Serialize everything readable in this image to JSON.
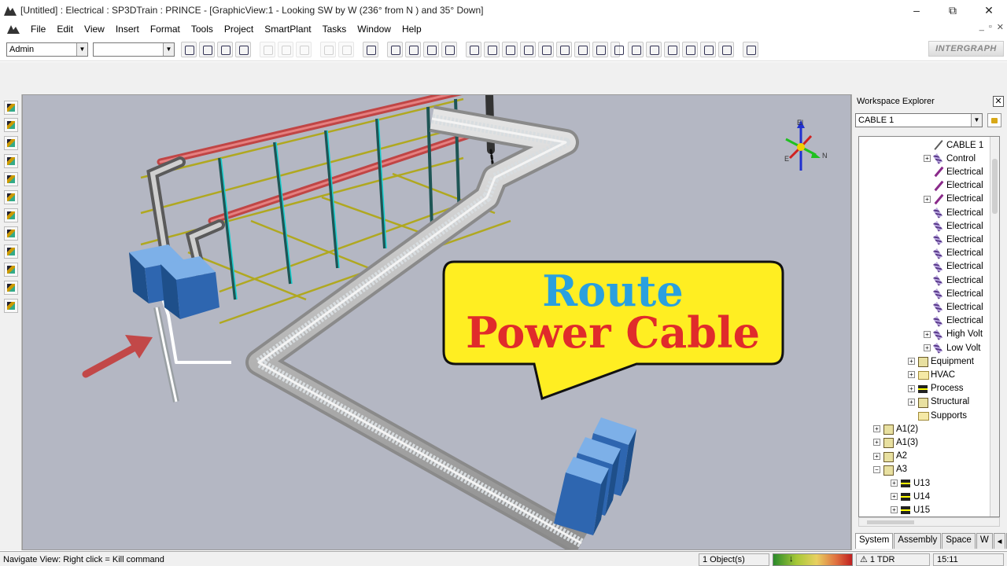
{
  "window": {
    "title": "[Untitled] : Electrical : SP3DTrain : PRINCE - [GraphicView:1 - Looking SW by W (236° from N ) and 35° Down]",
    "min": "–",
    "max": "⧉",
    "close": "✕"
  },
  "menu": [
    "File",
    "Edit",
    "View",
    "Insert",
    "Format",
    "Tools",
    "Project",
    "SmartPlant",
    "Tasks",
    "Window",
    "Help"
  ],
  "toolbar": {
    "user_combo": "Admin",
    "filter_combo": "",
    "logo": "INTERGRAPH"
  },
  "compass": {
    "up": "El",
    "east": "N",
    "west": "E"
  },
  "callout": {
    "line1": "Route",
    "line2": "Power Cable",
    "line1_color": "#2aa0de",
    "line2_color": "#e02b2b",
    "bg": "#ffee22"
  },
  "explorer": {
    "title": "Workspace Explorer",
    "combo": "CABLE 1",
    "tree": [
      {
        "label": "CABLE 1",
        "icon": "pen",
        "level": 4,
        "exp": ""
      },
      {
        "label": "Control",
        "icon": "cable",
        "level": 4,
        "exp": "+"
      },
      {
        "label": "Electrical",
        "icon": "pen2",
        "level": 4,
        "exp": ""
      },
      {
        "label": "Electrical",
        "icon": "pen2",
        "level": 4,
        "exp": ""
      },
      {
        "label": "Electrical",
        "icon": "pen2",
        "level": 4,
        "exp": "+"
      },
      {
        "label": "Electrical",
        "icon": "cable",
        "level": 4,
        "exp": ""
      },
      {
        "label": "Electrical",
        "icon": "cable",
        "level": 4,
        "exp": ""
      },
      {
        "label": "Electrical",
        "icon": "cable",
        "level": 4,
        "exp": ""
      },
      {
        "label": "Electrical",
        "icon": "cable",
        "level": 4,
        "exp": ""
      },
      {
        "label": "Electrical",
        "icon": "cable",
        "level": 4,
        "exp": ""
      },
      {
        "label": "Electrical",
        "icon": "cable",
        "level": 4,
        "exp": ""
      },
      {
        "label": "Electrical",
        "icon": "cable",
        "level": 4,
        "exp": ""
      },
      {
        "label": "Electrical",
        "icon": "cable",
        "level": 4,
        "exp": ""
      },
      {
        "label": "Electrical",
        "icon": "cable",
        "level": 4,
        "exp": ""
      },
      {
        "label": "High Volt",
        "icon": "cable",
        "level": 4,
        "exp": "+"
      },
      {
        "label": "Low Volt",
        "icon": "cable",
        "level": 4,
        "exp": "+"
      },
      {
        "label": "Equipment",
        "icon": "box",
        "level": 3,
        "exp": "+"
      },
      {
        "label": "HVAC",
        "icon": "folder",
        "level": 3,
        "exp": "+"
      },
      {
        "label": "Process",
        "icon": "plant",
        "level": 3,
        "exp": "+"
      },
      {
        "label": "Structural",
        "icon": "box",
        "level": 3,
        "exp": "+"
      },
      {
        "label": "Supports",
        "icon": "folder",
        "level": 3,
        "exp": ""
      },
      {
        "label": "A1(2)",
        "icon": "box",
        "level": 1,
        "exp": "+"
      },
      {
        "label": "A1(3)",
        "icon": "box",
        "level": 1,
        "exp": "+"
      },
      {
        "label": "A2",
        "icon": "box",
        "level": 1,
        "exp": "+"
      },
      {
        "label": "A3",
        "icon": "box",
        "level": 1,
        "exp": "−"
      },
      {
        "label": "U13",
        "icon": "plant",
        "level": 2,
        "exp": "+"
      },
      {
        "label": "U14",
        "icon": "plant",
        "level": 2,
        "exp": "+"
      },
      {
        "label": "U15",
        "icon": "plant",
        "level": 2,
        "exp": "+"
      }
    ],
    "tabs": [
      "System",
      "Assembly",
      "Space",
      "W"
    ]
  },
  "status": {
    "message": "Navigate View: Right click = Kill command",
    "objects": "1 Object(s)",
    "tdr": "1 TDR",
    "time": "15:11"
  }
}
